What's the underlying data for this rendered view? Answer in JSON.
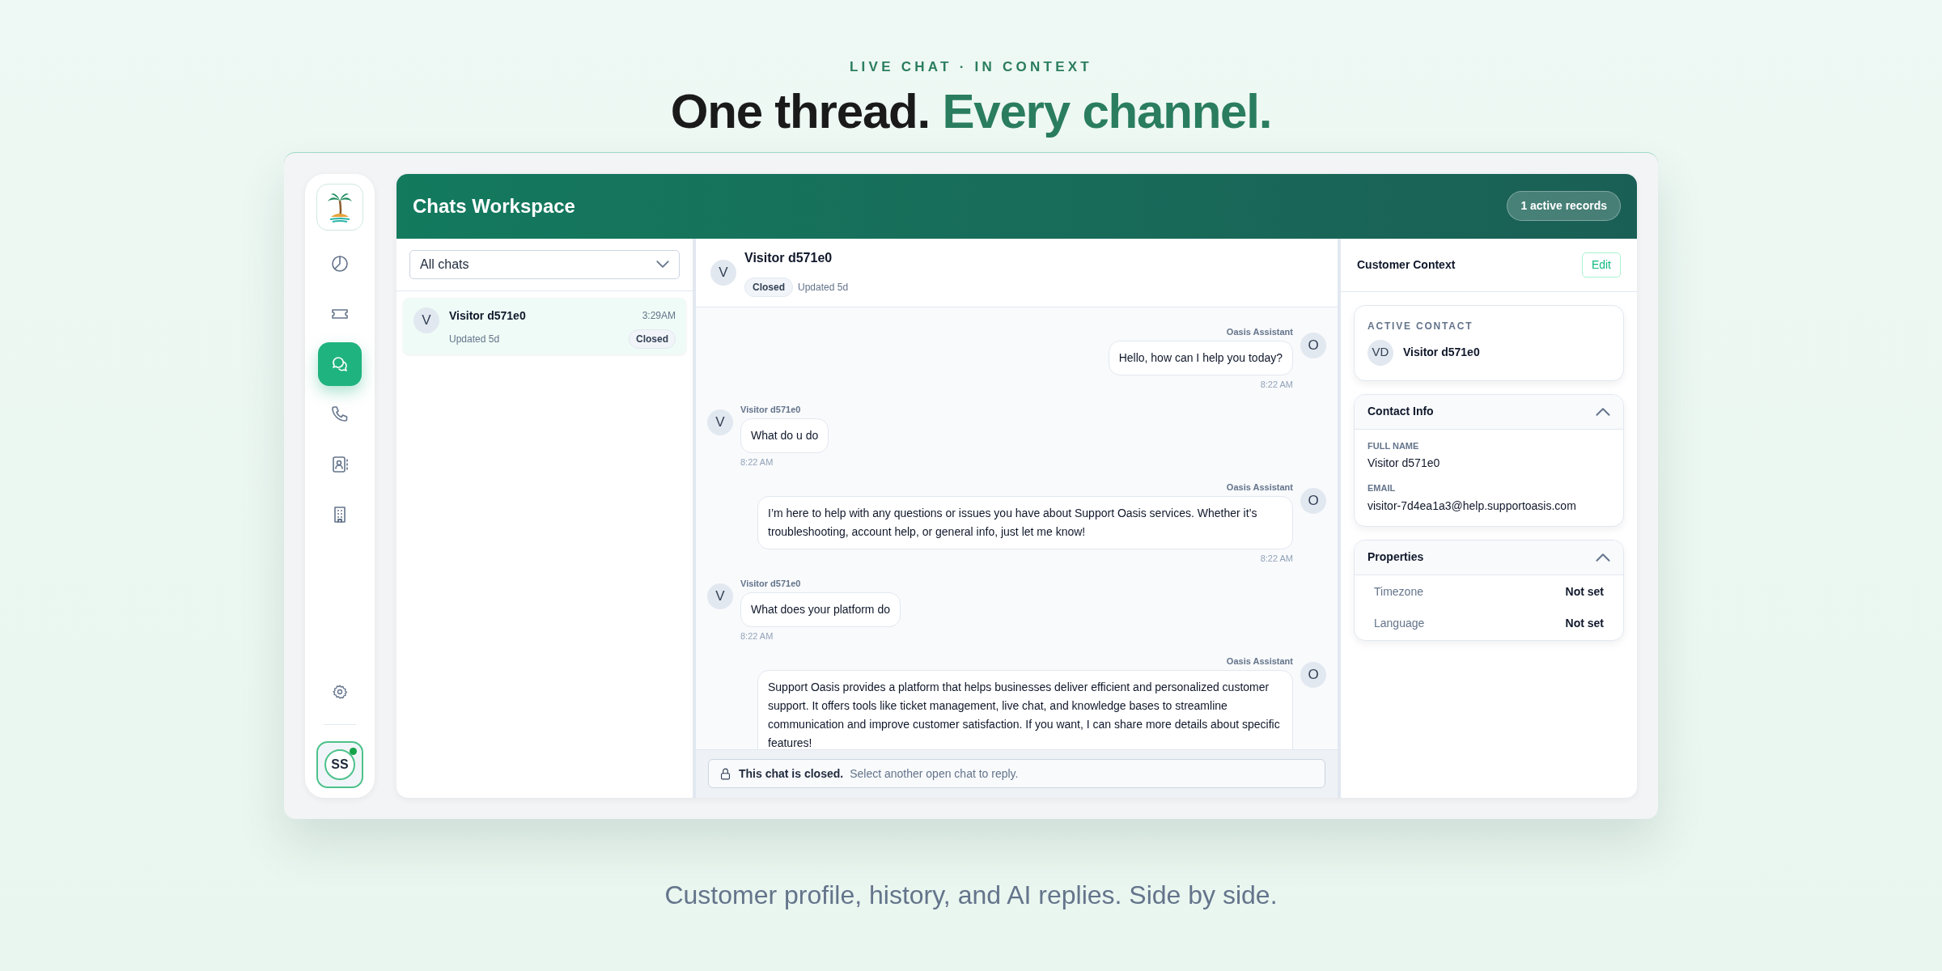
{
  "eyebrow": "LIVE CHAT · IN CONTEXT",
  "headline": {
    "lead": "One thread.",
    "accent": "Every channel."
  },
  "nav": [
    {
      "kind": "pie",
      "selected": false
    },
    {
      "kind": "ticket",
      "selected": false
    },
    {
      "kind": "chat",
      "selected": true
    },
    {
      "kind": "phone",
      "selected": false
    },
    {
      "kind": "contacts",
      "selected": false
    },
    {
      "kind": "building",
      "selected": false
    }
  ],
  "user": {
    "initials": "SS",
    "online": true
  },
  "workspace": {
    "title": "Chats Workspace",
    "badge": "1 active records"
  },
  "filter": {
    "value": "All chats"
  },
  "chats": [
    {
      "initial": "V",
      "name": "Visitor d571e0",
      "time": "3:29AM",
      "updated": "Updated 5d",
      "status": "Closed",
      "selected": true
    }
  ],
  "conversation": {
    "initial": "V",
    "name": "Visitor d571e0",
    "status": "Closed",
    "updated": "Updated 5d",
    "messages": [
      {
        "kind": "agent",
        "sender": "Oasis Assistant",
        "initial": "O",
        "text": "Hello, how can I help you today?",
        "time": "8:22 AM"
      },
      {
        "kind": "visitor",
        "sender": "Visitor d571e0",
        "initial": "V",
        "text": "What do u do",
        "time": "8:22 AM"
      },
      {
        "kind": "agent",
        "sender": "Oasis Assistant",
        "initial": "O",
        "text": "I’m here to help with any questions or issues you have about Support Oasis services. Whether it’s troubleshooting, account help, or general info, just let me know!",
        "time": "8:22 AM"
      },
      {
        "kind": "visitor",
        "sender": "Visitor d571e0",
        "initial": "V",
        "text": "What does your platform do",
        "time": "8:22 AM"
      },
      {
        "kind": "agent",
        "sender": "Oasis Assistant",
        "initial": "O",
        "text": "Support Oasis provides a platform that helps businesses deliver efficient and personalized customer support. It offers tools like ticket management, live chat, and knowledge bases to streamline communication and improve customer satisfaction. If you want, I can share more details about specific features!"
      }
    ],
    "closed_notice": {
      "title": "This chat is closed.",
      "hint": "Select another open chat to reply."
    }
  },
  "context": {
    "title": "Customer Context",
    "edit": "Edit",
    "active_contact": {
      "label": "ACTIVE CONTACT",
      "initials": "VD",
      "name": "Visitor d571e0"
    },
    "sections": [
      {
        "kind": "fields",
        "title": "Contact Info",
        "expanded": true,
        "items": [
          {
            "label": "FULL NAME",
            "value": "Visitor d571e0"
          },
          {
            "label": "EMAIL",
            "value": "visitor-7d4ea1a3@help.supportoasis.com"
          }
        ]
      },
      {
        "kind": "properties",
        "title": "Properties",
        "expanded": true,
        "items": [
          {
            "label": "Timezone",
            "value": "Not set"
          },
          {
            "label": "Language",
            "value": "Not set"
          }
        ]
      }
    ]
  },
  "caption": "Customer profile, history, and AI replies. Side by side."
}
